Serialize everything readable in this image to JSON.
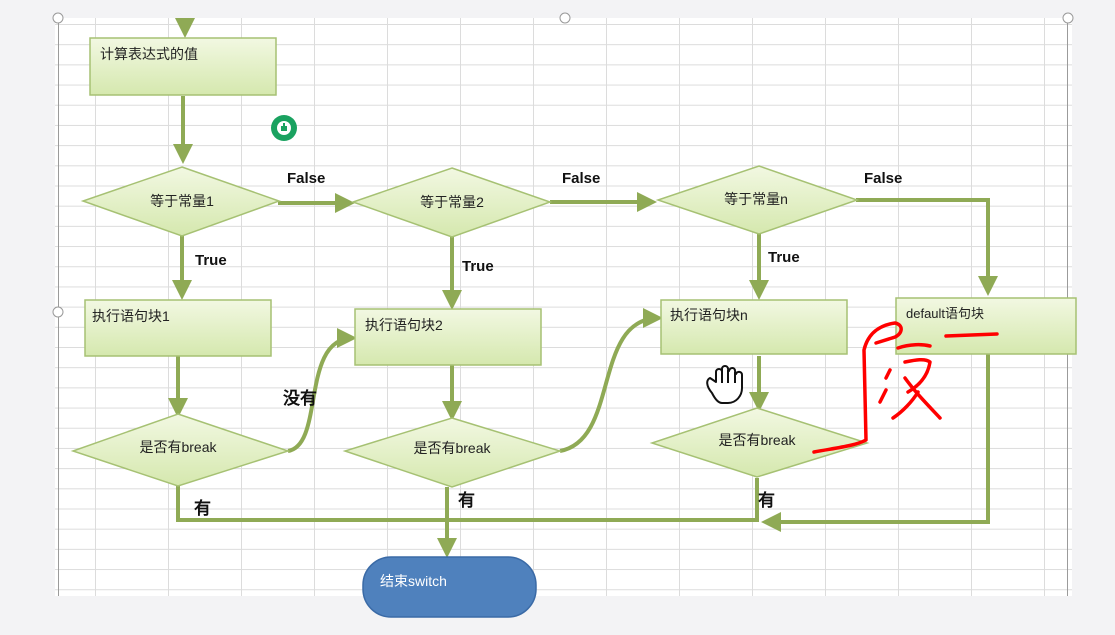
{
  "diagram": {
    "start_box": "计算表达式的值",
    "conditions": [
      "等于常量1",
      "等于常量2",
      "等于常量n"
    ],
    "blocks": [
      "执行语句块1",
      "执行语句块2",
      "执行语句块n",
      "default语句块"
    ],
    "break_checks": [
      "是否有break",
      "是否有break",
      "是否有break"
    ],
    "edge_labels": {
      "false": "False",
      "true": "True",
      "no": "没有",
      "yes": "有"
    },
    "end_node": "结束switch",
    "annotation": "没"
  },
  "colors": {
    "arrow": "#8faa55",
    "shape_fill": "#e4f1c7",
    "shape_stroke": "#a6c173",
    "end_fill": "#4f81bd",
    "annotation": "#ff0000"
  },
  "icons": [
    "hand-cursor-icon",
    "grab-hand-icon"
  ]
}
